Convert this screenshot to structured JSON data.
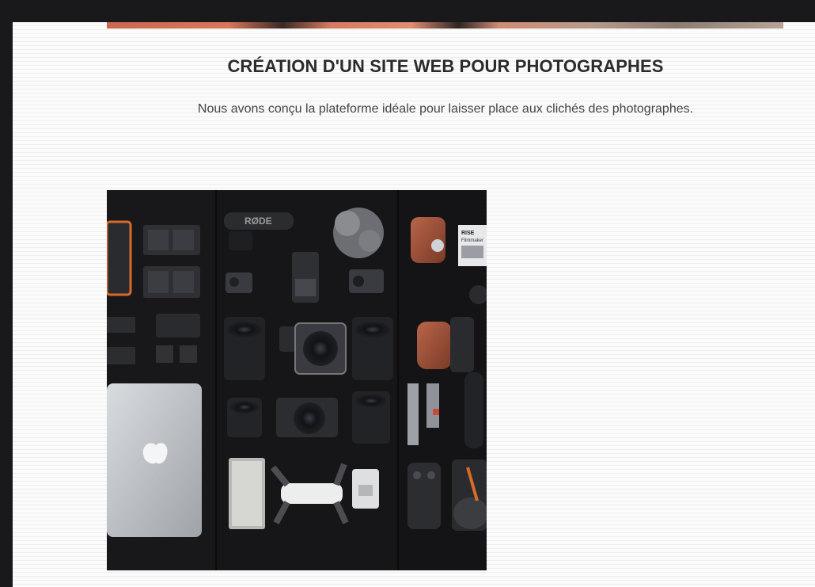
{
  "section": {
    "title": "CRÉATION D'UN SITE WEB POUR PHOTOGRAPHES",
    "subtitle": "Nous avons conçu la plateforme idéale pour laisser place aux clichés des photographes."
  },
  "photo": {
    "brand_label": "RØDE",
    "card_label_1": "RISE",
    "card_label_2": "Filmmaker"
  },
  "colors": {
    "page_bg": "#fafafa",
    "frame_bg": "#19191b",
    "title_text": "#2b2b2b",
    "body_text": "#444444",
    "photo_bg": "#141416"
  }
}
